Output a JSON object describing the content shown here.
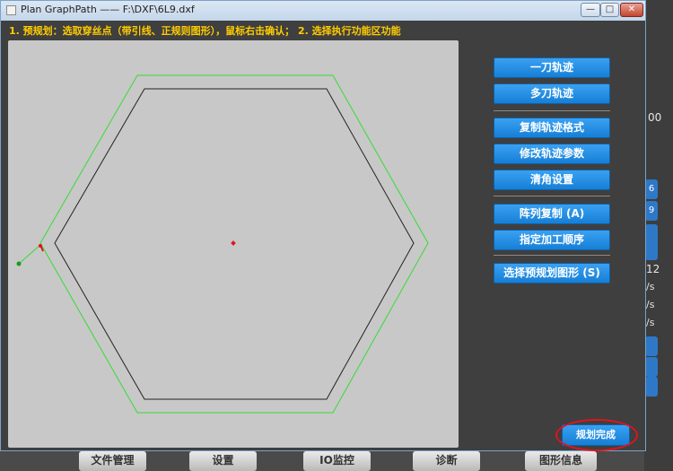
{
  "window": {
    "title": "Plan GraphPath —— F:\\DXF\\6L9.dxf",
    "minimize_glyph": "—",
    "maximize_glyph": "□",
    "close_glyph": "✕"
  },
  "hint": "1. 预规划：选取穿丝点（带引线、正规则图形），鼠标右击确认；  2. 选择执行功能区功能",
  "buttons": {
    "single_path": "一刀轨迹",
    "multi_path": "多刀轨迹",
    "copy_format": "复制轨迹格式",
    "modify_params": "修改轨迹参数",
    "corner_setting": "清角设置",
    "array_copy": "阵列复制 (A)",
    "set_order": "指定加工顺序",
    "select_shape": "选择预规划图形 (S)",
    "finish": "规划完成"
  },
  "background": {
    "right_values": [
      "00",
      "6",
      "9",
      "12",
      "/s",
      "/s",
      "/s"
    ],
    "taskbar": [
      "文件管理",
      "设置",
      "IO监控",
      "诊断",
      "图形信息"
    ]
  },
  "colors": {
    "accent_blue": "#1a8ae6",
    "hint_yellow": "#ffcc00",
    "offset_path": "#33dd33",
    "part_outline": "#222222",
    "highlight_ring": "#e0141e"
  }
}
